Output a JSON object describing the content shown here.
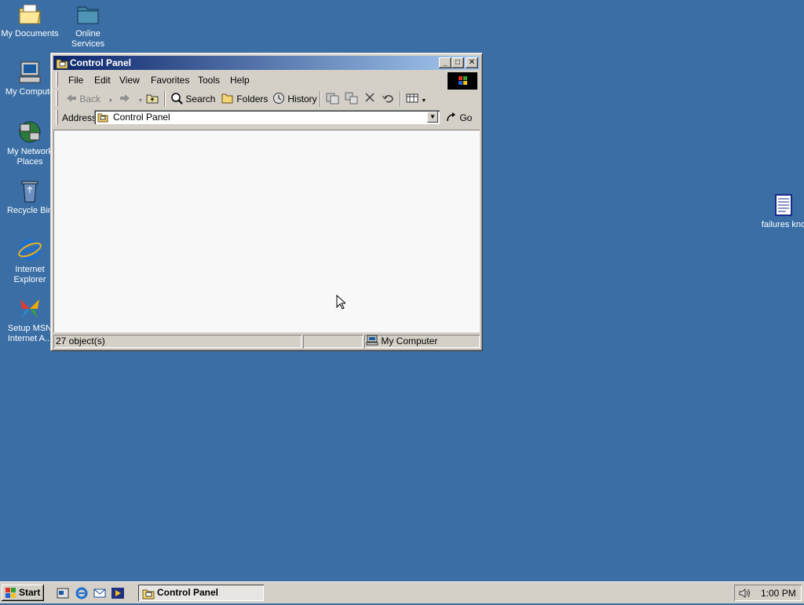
{
  "desktop": {
    "icons": [
      {
        "name": "my-documents",
        "label": "My Documents"
      },
      {
        "name": "online-services",
        "label": "Online\nServices"
      },
      {
        "name": "my-computer",
        "label": "My Compute"
      },
      {
        "name": "my-network-places",
        "label": "My Network\nPlaces"
      },
      {
        "name": "recycle-bin",
        "label": "Recycle Bin"
      },
      {
        "name": "internet-explorer",
        "label": "Internet\nExplorer"
      },
      {
        "name": "setup-msn",
        "label": "Setup MSN\nInternet A..."
      },
      {
        "name": "failures-file",
        "label": "failures kno"
      }
    ],
    "background_color": "#3a6ea5"
  },
  "window": {
    "title": "Control Panel",
    "controls": {
      "minimize": "_",
      "maximize": "□",
      "close": "✕"
    },
    "menu": [
      "File",
      "Edit",
      "View",
      "Favorites",
      "Tools",
      "Help"
    ],
    "toolbar": {
      "back": "Back",
      "search": "Search",
      "folders": "Folders",
      "history": "History"
    },
    "address": {
      "label": "Address",
      "value": "Control Panel",
      "go": "Go"
    },
    "status": {
      "objects": "27 object(s)",
      "zone": "My Computer"
    }
  },
  "taskbar": {
    "start": "Start",
    "task": "Control Panel",
    "clock": "1:00 PM"
  }
}
